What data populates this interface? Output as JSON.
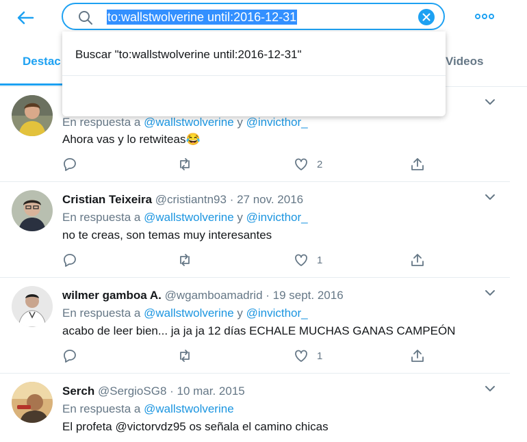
{
  "search": {
    "query": "to:wallstwolverine until:2016-12-31"
  },
  "tabs": [
    {
      "label": "Destac"
    },
    {
      "label": "Videos"
    }
  ],
  "dropdown": {
    "item_label": "Buscar \"to:wallstwolverine until:2016-12-31\""
  },
  "tweets": [
    {
      "name": "",
      "handle": "",
      "date": "",
      "reply_prefix": "En respuesta a ",
      "mention1": "@wallstwolverine",
      "joiner": " y ",
      "mention2": "@invicthor_",
      "text": "Ahora vas y lo retwiteas😂",
      "likes": "2"
    },
    {
      "name": "Cristian Teixeira",
      "handle": "@cristiantn93",
      "sep": " · ",
      "date": "27 nov. 2016",
      "reply_prefix": "En respuesta a ",
      "mention1": "@wallstwolverine",
      "joiner": " y ",
      "mention2": "@invicthor_",
      "text": "no te creas, son temas muy interesantes",
      "likes": "1"
    },
    {
      "name": "wilmer gamboa A.",
      "handle": "@wgamboamadrid",
      "sep": " · ",
      "date": "19 sept. 2016",
      "reply_prefix": "En respuesta a ",
      "mention1": "@wallstwolverine",
      "joiner": " y ",
      "mention2": "@invicthor_",
      "text": "acabo de leer bien... ja ja ja 12 días ECHALE MUCHAS GANAS CAMPEÓN",
      "likes": "1"
    },
    {
      "name": "Serch",
      "handle": "@SergioSG8",
      "sep": " · ",
      "date": "10 mar. 2015",
      "reply_prefix": "En respuesta a ",
      "mention1": "@wallstwolverine",
      "text": "El profeta @victorvdz95 os señala el camino chicas"
    }
  ],
  "colors": {
    "accent": "#1da1f2",
    "muted": "#657786",
    "mention": "#1b95e0"
  }
}
